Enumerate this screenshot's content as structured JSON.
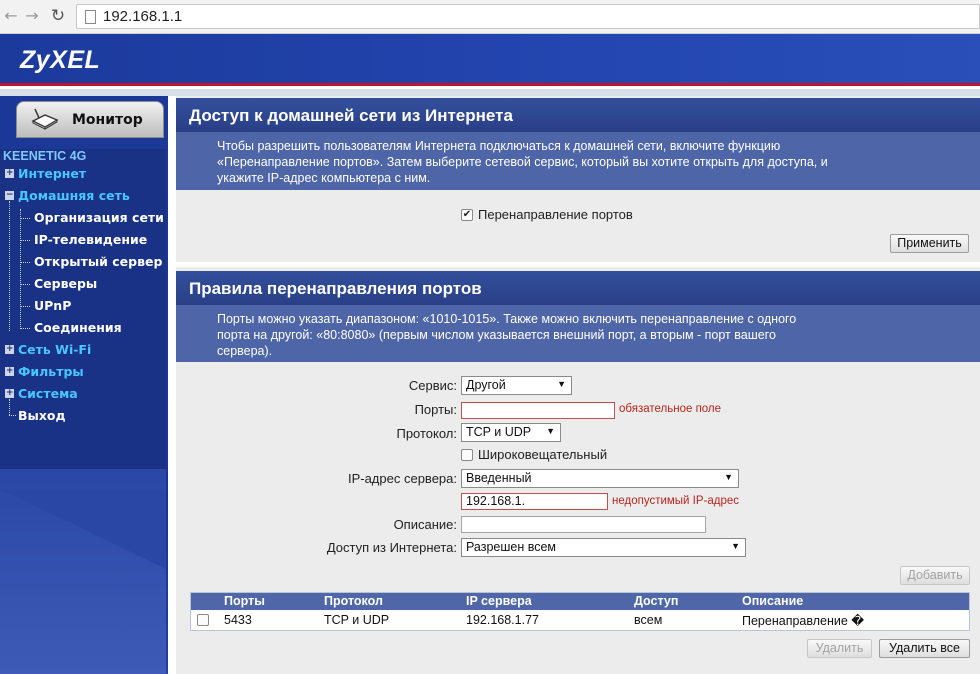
{
  "browser": {
    "url": "192.168.1.1"
  },
  "header": {
    "logo": "ZyXEL"
  },
  "sidebar": {
    "tab_label": "Монитор",
    "device_name": "KEENETIC 4G",
    "items": [
      {
        "label": "Интернет"
      },
      {
        "label": "Домашняя сеть"
      },
      {
        "label": "Организация сети"
      },
      {
        "label": "IP-телевидение"
      },
      {
        "label": "Открытый сервер"
      },
      {
        "label": "Серверы"
      },
      {
        "label": "UPnP"
      },
      {
        "label": "Соединения"
      },
      {
        "label": "Сеть Wi-Fi"
      },
      {
        "label": "Фильтры"
      },
      {
        "label": "Система"
      },
      {
        "label": "Выход"
      }
    ]
  },
  "section1": {
    "title": "Доступ к домашней сети из Интернета",
    "desc_line1": "Чтобы разрешить пользователям Интернета подключаться к домашней сети, включите функцию",
    "desc_line2": "«Перенаправление портов». Затем выберите сетевой сервис, который вы хотите открыть для доступа, и",
    "desc_line3": "укажите IP-адрес компьютера с ним.",
    "checkbox_label": "Перенаправление портов",
    "checkbox_checked": true,
    "apply_label": "Применить"
  },
  "section2": {
    "title": "Правила перенаправления портов",
    "desc_line1": "Порты можно указать диапазоном: «1010-1015». Также можно включить перенаправление с одного",
    "desc_line2": "порта на другой: «80:8080» (первым числом указывается внешний порт, а вторым - порт вашего",
    "desc_line3": "сервера)."
  },
  "form": {
    "service_label": "Сервис:",
    "service_value": "Другой",
    "ports_label": "Порты:",
    "ports_value": "",
    "ports_error": "обязательное поле",
    "protocol_label": "Протокол:",
    "protocol_value": "TCP и UDP",
    "broadcast_label": "Широковещательный",
    "ip_label": "IP-адрес сервера:",
    "ip_mode_value": "Введенный",
    "ip_value": "192.168.1.",
    "ip_error": "недопустимый IP-адрес",
    "description_label": "Описание:",
    "description_value": "",
    "access_label": "Доступ из Интернета:",
    "access_value": "Разрешен всем",
    "add_label": "Добавить"
  },
  "table": {
    "headers": [
      "Порты",
      "Протокол",
      "IP сервера",
      "Доступ",
      "Описание"
    ],
    "rows": [
      {
        "ports": "5433",
        "protocol": "TCP и UDP",
        "ip": "192.168.1.77",
        "access": "всем",
        "description": "Перенаправление �"
      }
    ],
    "delete_label": "Удалить",
    "delete_all_label": "Удалить все"
  }
}
